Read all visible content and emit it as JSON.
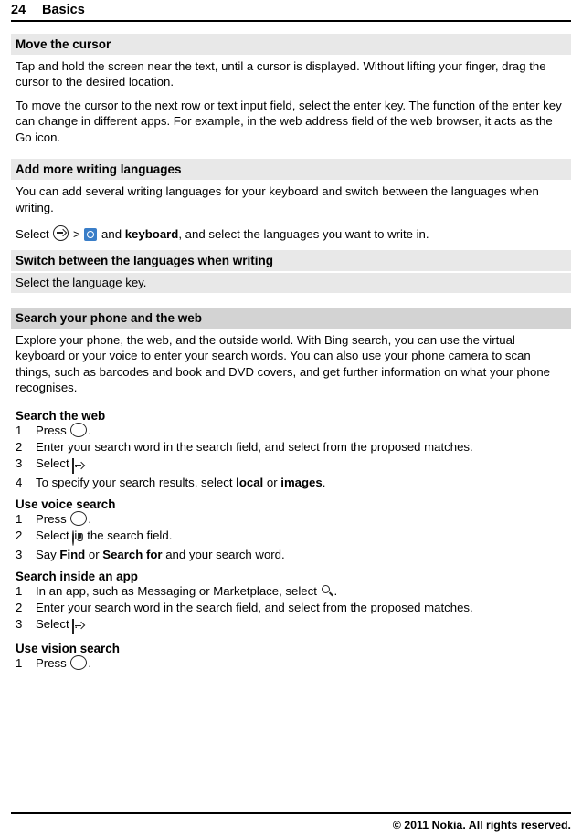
{
  "header": {
    "page_number": "24",
    "chapter": "Basics"
  },
  "sections": [
    {
      "heading": "Move the cursor",
      "paragraphs": [
        "Tap and hold the screen near the text, until a cursor is displayed. Without lifting your finger, drag the cursor to the desired location.",
        "To move the cursor to the next row or text input field, select the enter key. The function of the enter key can change in different apps. For example, in the web address field of the web browser, it acts as the Go icon."
      ]
    },
    {
      "heading": "Add more writing languages",
      "paragraphs": [
        "You can add several writing languages for your keyboard and switch between the languages when writing."
      ],
      "select_line_prefix": "Select",
      "select_line_mid": " and ",
      "select_line_bold": "keyboard",
      "select_line_suffix": ", and select the languages you want to write in.",
      "select_separator": ">"
    },
    {
      "heading": "Switch between the languages when writing",
      "paragraphs": [
        "Select the language key."
      ]
    },
    {
      "heading": "Search your phone and the web",
      "paragraphs": [
        "Explore your phone, the web, and the outside world. With Bing search, you can use the virtual keyboard or your voice to enter your search words. You can also use your phone camera to scan things, such as barcodes and book and DVD covers, and get further information on what your phone recognises."
      ]
    }
  ],
  "procedures": [
    {
      "title": "Search the web",
      "steps": [
        {
          "num": "1",
          "pre": "Press ",
          "icon": "search-circle-icon",
          "post": "."
        },
        {
          "num": "2",
          "pre": "Enter your search word in the search field, and select from the proposed matches.",
          "icon": "",
          "post": ""
        },
        {
          "num": "3",
          "pre": "Select ",
          "icon": "arrow-square-icon",
          "post": "."
        },
        {
          "num": "4",
          "pre": "To specify your search results, select ",
          "icon": "",
          "post": ".",
          "bold1": "local",
          "mid": " or ",
          "bold2": "images"
        }
      ]
    },
    {
      "title": "Use voice search",
      "steps": [
        {
          "num": "1",
          "pre": "Press ",
          "icon": "search-circle-icon",
          "post": "."
        },
        {
          "num": "2",
          "pre": "Select ",
          "icon": "microphone-icon",
          "post": " in the search field."
        },
        {
          "num": "3",
          "pre": "Say ",
          "icon": "",
          "post": " and your search word.",
          "bold1": "Find",
          "mid": " or ",
          "bold2": "Search for"
        }
      ]
    },
    {
      "title": "Search inside an app",
      "steps": [
        {
          "num": "1",
          "pre": "In an app, such as Messaging or Marketplace, select ",
          "icon": "magnifier-icon",
          "post": "."
        },
        {
          "num": "2",
          "pre": "Enter your search word in the search field, and select from the proposed matches.",
          "icon": "",
          "post": ""
        },
        {
          "num": "3",
          "pre": "Select ",
          "icon": "arrow-square-icon",
          "post": "."
        }
      ]
    },
    {
      "title": "Use vision search",
      "steps": [
        {
          "num": "1",
          "pre": "Press ",
          "icon": "search-circle-icon",
          "post": "."
        }
      ]
    }
  ],
  "footer": {
    "copyright": "© 2011 Nokia. All rights reserved."
  }
}
